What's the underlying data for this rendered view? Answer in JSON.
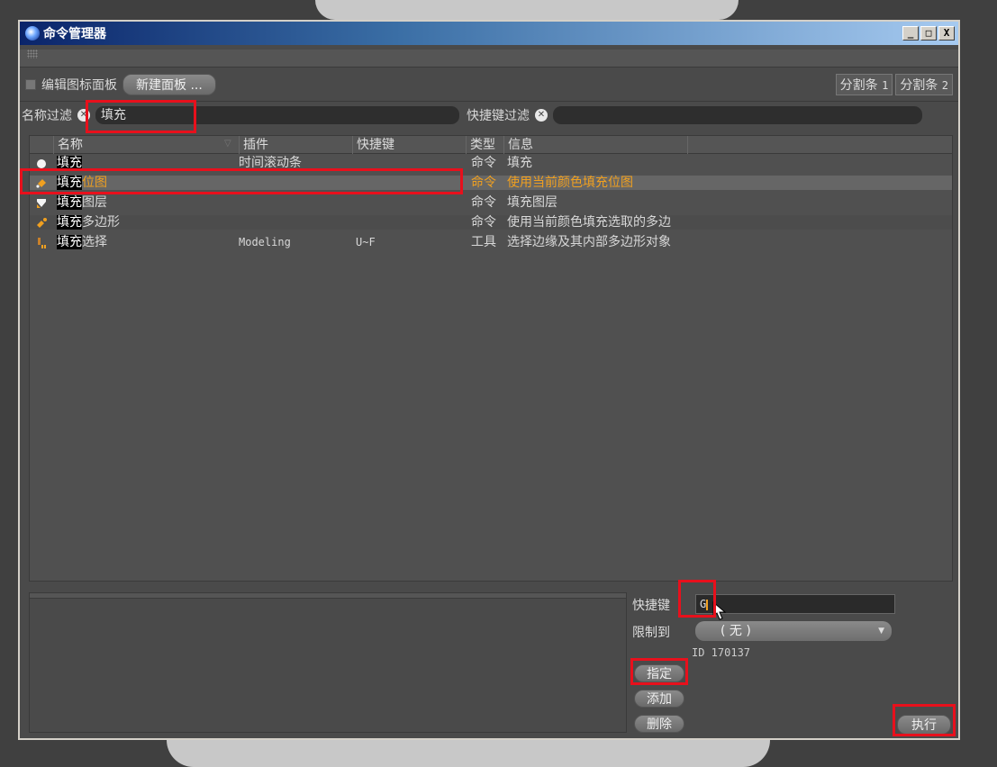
{
  "window": {
    "title": "命令管理器",
    "buttons": {
      "minimize": "_",
      "maximize": "□",
      "close": "X"
    }
  },
  "toolbar": {
    "edit_panel_label": "编辑图标面板",
    "new_panel_button": "新建面板 ...",
    "split1_label": "分割条",
    "split1_num": "1",
    "split2_label": "分割条",
    "split2_num": "2"
  },
  "filters": {
    "name_label": "名称过滤",
    "name_value": "填充",
    "shortcut_label": "快捷键过滤",
    "shortcut_value": ""
  },
  "table": {
    "headers": {
      "name": "名称",
      "plugin": "插件",
      "shortcut": "快捷键",
      "type": "类型",
      "info": "信息"
    },
    "rows": [
      {
        "name_hl": "填充",
        "name_rest": "",
        "plugin": "时间滚动条",
        "shortcut": "",
        "type": "命令",
        "info": "填充",
        "icon": "white-dot-icon"
      },
      {
        "name_hl": "填充",
        "name_rest": "位图",
        "plugin": "",
        "shortcut": "",
        "type": "命令",
        "info": "使用当前颜色填充位图",
        "icon": "paint-bucket-icon",
        "selected": true
      },
      {
        "name_hl": "填充",
        "name_rest": "图层",
        "plugin": "",
        "shortcut": "",
        "type": "命令",
        "info": "填充图层",
        "icon": "fill-layer-icon"
      },
      {
        "name_hl": "填充",
        "name_rest": "多边形",
        "plugin": "",
        "shortcut": "",
        "type": "命令",
        "info": "使用当前颜色填充选取的多边",
        "icon": "fill-polygon-icon"
      },
      {
        "name_hl": "填充",
        "name_rest": "选择",
        "plugin": "Modeling",
        "shortcut": "U~F",
        "type": "工具",
        "info": "选择边缘及其内部多边形对象",
        "icon": "fill-select-icon"
      }
    ]
  },
  "detail": {
    "shortcut_label": "快捷键",
    "shortcut_value": "G",
    "restrict_label": "限制到",
    "restrict_value": "( 无 )",
    "id_text": "ID 170137",
    "assign_button": "指定",
    "add_button": "添加",
    "delete_button": "删除",
    "execute_button": "执行"
  },
  "colors": {
    "highlight": "#f0a020",
    "annotation": "#e8101c",
    "title_gradient_start": "#0a246a"
  }
}
